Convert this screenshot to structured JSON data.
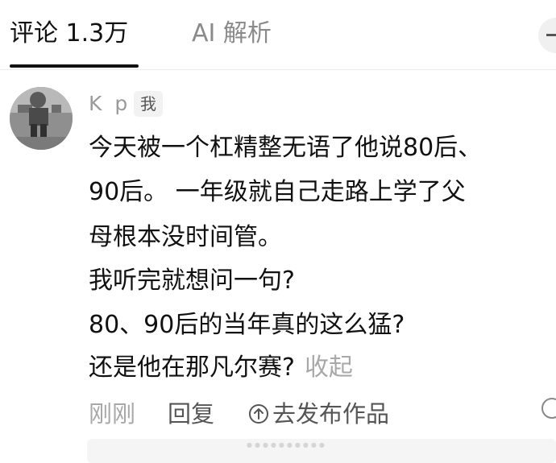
{
  "tabs": [
    {
      "label": "评论 1.3万"
    },
    {
      "label": "AI 解析"
    }
  ],
  "comment": {
    "username": "K p",
    "badge": "我",
    "lines": [
      "今天被一个杠精整无语了他说80后、",
      "90后。 一年级就自己走路上学了父",
      "母根本没时间管。",
      "我听完就想问一句?",
      "80、90后的当年真的这么猛?",
      "还是他在那凡尔赛?"
    ],
    "collapse_label": "收起",
    "time": "刚刚",
    "reply_label": "回复",
    "publish_label": "去发布作品"
  },
  "icons": {
    "avatar": "avatar",
    "publish": "arrow-up-circle-icon",
    "like": "like-icon",
    "close": "close-icon"
  }
}
